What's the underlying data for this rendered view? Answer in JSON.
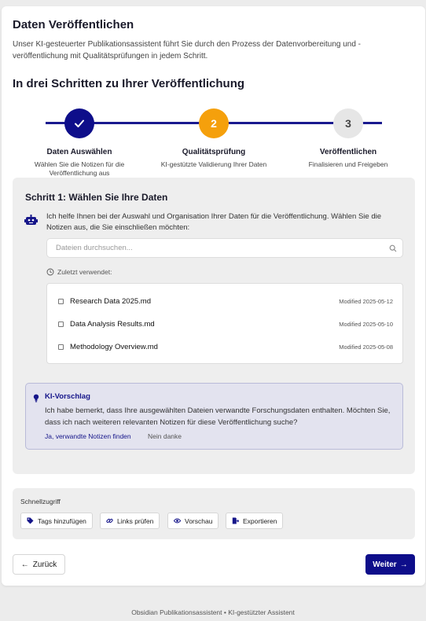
{
  "header": {
    "title": "Daten Veröffentlichen",
    "intro": "Unser KI-gesteuerter Publikationsassistent führt Sie durch den Prozess der Datenvorbereitung und -veröffentlichung mit Qualitätsprüfungen in jedem Schritt."
  },
  "steps_heading": "In drei Schritten zu Ihrer Veröffentlichung",
  "steps": [
    {
      "number": "1",
      "state": "done",
      "icon": "check-icon",
      "title": "Daten Auswählen",
      "desc": "Wählen Sie die Notizen für die Veröffentlichung aus"
    },
    {
      "number": "2",
      "state": "active",
      "title": "Qualitätsprüfung",
      "desc": "KI-gestützte Validierung Ihrer Daten"
    },
    {
      "number": "3",
      "state": "pending",
      "title": "Veröffentlichen",
      "desc": "Finalisieren und Freigeben"
    }
  ],
  "panel": {
    "title": "Schritt 1: Wählen Sie Ihre Daten",
    "assistant_icon": "robot-icon",
    "assistant_message": "Ich helfe Ihnen bei der Auswahl und Organisation Ihrer Daten für die Veröffentlichung. Wählen Sie die Notizen aus, die Sie einschließen möchten:",
    "search": {
      "placeholder": "Dateien durchsuchen...",
      "value": ""
    },
    "recent_label": "Zuletzt verwendet:",
    "files": [
      {
        "name": "Research Data 2025.md",
        "modified": "Modified 2025-05-12",
        "checked": false
      },
      {
        "name": "Data Analysis Results.md",
        "modified": "Modified 2025-05-10",
        "checked": false
      },
      {
        "name": "Methodology Overview.md",
        "modified": "Modified 2025-05-08",
        "checked": false
      }
    ],
    "ai": {
      "icon": "lightbulb-icon",
      "title": "KI-Vorschlag",
      "text": "Ich habe bemerkt, dass Ihre ausgewählten Dateien verwandte Forschungsdaten enthalten. Möchten Sie, dass ich nach weiteren relevanten Notizen für diese Veröffentlichung suche?",
      "accept_label": "Ja, verwandte Notizen finden",
      "decline_label": "Nein danke"
    }
  },
  "quick": {
    "title": "Schnellzugriff",
    "buttons": [
      {
        "label": "Tags hinzufügen",
        "icon": "tag-icon"
      },
      {
        "label": "Links prüfen",
        "icon": "link-icon"
      },
      {
        "label": "Vorschau",
        "icon": "eye-icon"
      },
      {
        "label": "Exportieren",
        "icon": "export-icon"
      }
    ]
  },
  "nav": {
    "back_label": "Zurück",
    "next_label": "Weiter"
  },
  "footer": "Obsidian Publikationsassistent • KI-gestützter Assistent",
  "colors": {
    "primary": "#0e0e8a",
    "active_step": "#f5a00c",
    "pending_step": "#e6e6e6",
    "ai_box_bg": "#e3e3ef"
  }
}
